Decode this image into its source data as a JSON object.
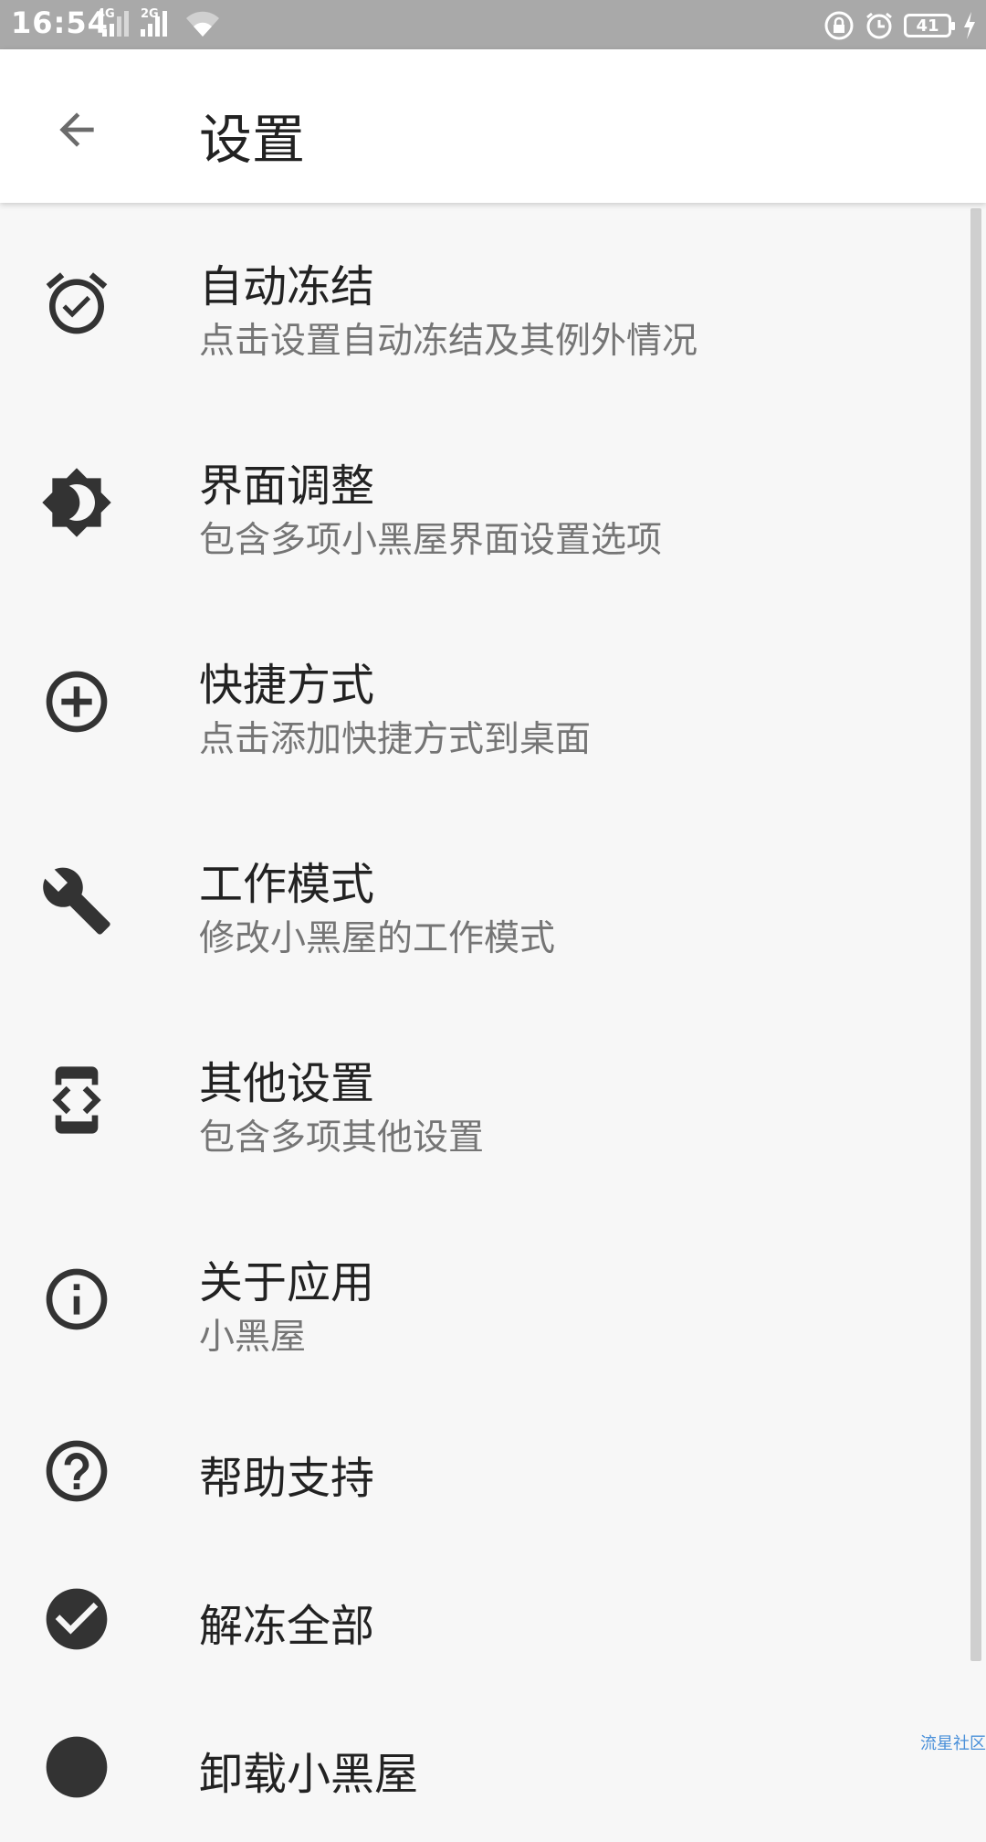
{
  "status_bar": {
    "time": "16:54",
    "net1": "4G",
    "net2": "2G",
    "battery": "41",
    "icons": [
      "signal-icon",
      "wifi-icon",
      "lock-icon",
      "alarm-icon",
      "battery-icon",
      "charging-icon"
    ]
  },
  "app_bar": {
    "back_icon": "arrow-left-icon",
    "title": "设置"
  },
  "settings": [
    {
      "icon": "alarm-check-icon",
      "title": "自动冻结",
      "subtitle": "点击设置自动冻结及其例外情况"
    },
    {
      "icon": "brightness-icon",
      "title": "界面调整",
      "subtitle": "包含多项小黑屋界面设置选项"
    },
    {
      "icon": "add-circle-icon",
      "title": "快捷方式",
      "subtitle": "点击添加快捷方式到桌面"
    },
    {
      "icon": "wrench-icon",
      "title": "工作模式",
      "subtitle": "修改小黑屋的工作模式"
    },
    {
      "icon": "developer-mode-icon",
      "title": "其他设置",
      "subtitle": "包含多项其他设置"
    },
    {
      "icon": "info-icon",
      "title": "关于应用",
      "subtitle": "小黑屋"
    },
    {
      "icon": "help-icon",
      "title": "帮助支持"
    },
    {
      "icon": "check-circle-icon",
      "title": "解冻全部"
    },
    {
      "icon": "circle-icon",
      "title": "卸载小黑屋"
    }
  ],
  "watermark": "流星社区"
}
